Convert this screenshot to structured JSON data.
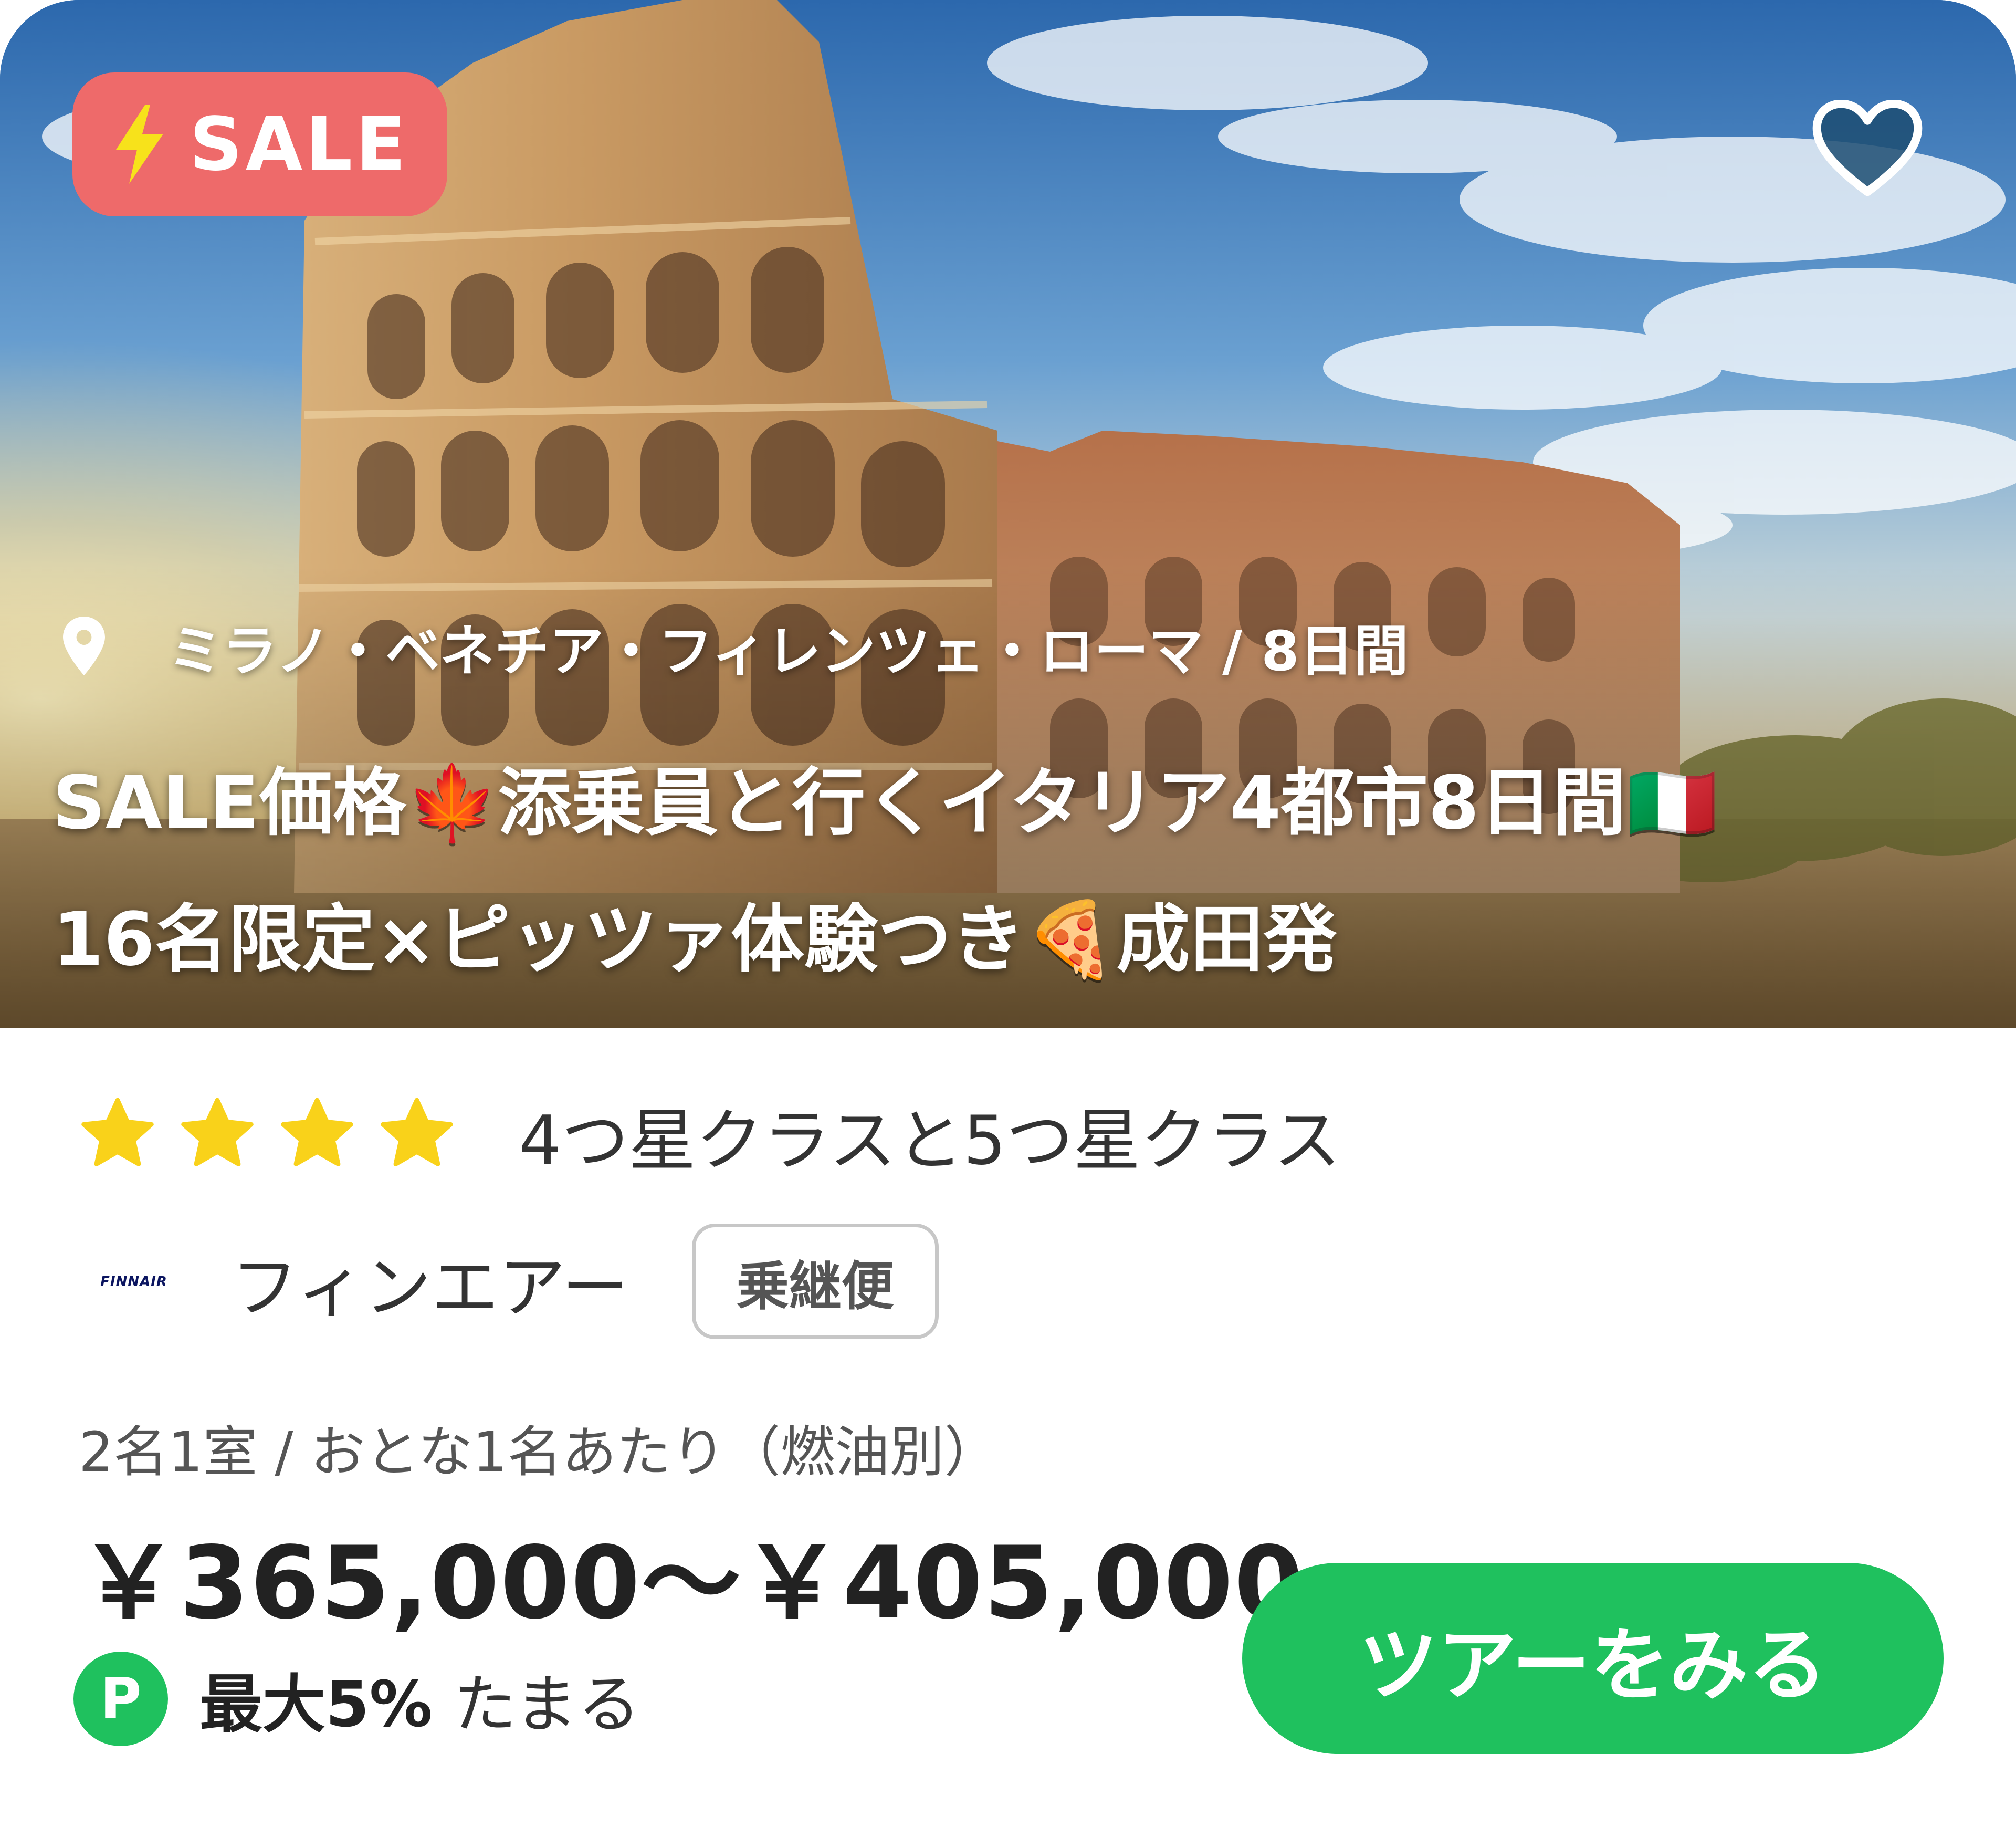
{
  "hero": {
    "image": "colosseum-photo",
    "sale_badge": {
      "icon": "lightning-bolt-icon",
      "label": "SALE"
    },
    "favorite_icon": "heart-icon",
    "location": {
      "icon": "map-pin-icon",
      "text": "ミラノ・ベネチア・フィレンツェ・ローマ / 8日間"
    },
    "title_lines": [
      "SALE価格🍁添乗員と行くイタリア4都市8日間🇮🇹",
      "16名限定×ピッツァ体験つき🍕成田発"
    ]
  },
  "hotel": {
    "stars": 4,
    "class_text": "4つ星クラスと5つ星クラス"
  },
  "airline": {
    "logo_text": "FINNAIR",
    "name": "フィンエアー",
    "flight_type": "乗継便"
  },
  "pricing": {
    "note": "2名1室 / おとな1名あたり（燃油別）",
    "range": "￥365,000〜￥405,000"
  },
  "points": {
    "icon_label": "P",
    "strong": "最大5%",
    "text": "たまる"
  },
  "cta": {
    "label": "ツアーをみる"
  },
  "colors": {
    "sale_badge": "#ee6a6a",
    "accent_green": "#1fc15e",
    "star": "#f9d21a",
    "finnair_navy": "#0b1560"
  }
}
